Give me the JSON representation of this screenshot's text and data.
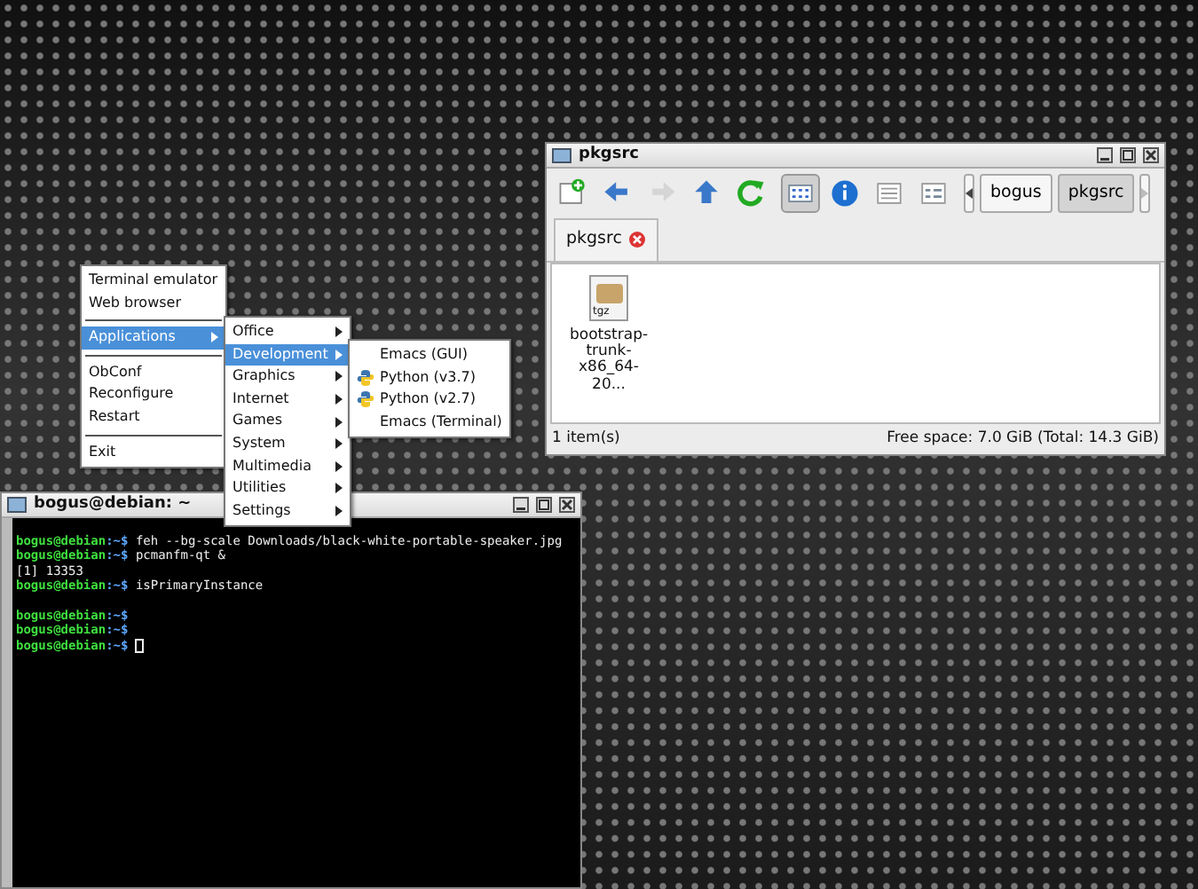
{
  "file_manager": {
    "title": "pkgsrc",
    "toolbar": [
      {
        "kind": "new-tab",
        "disabled": false,
        "selected": false
      },
      {
        "kind": "back",
        "disabled": false,
        "selected": false
      },
      {
        "kind": "forward",
        "disabled": true,
        "selected": false
      },
      {
        "kind": "up",
        "disabled": false,
        "selected": false
      },
      {
        "kind": "reload",
        "disabled": false,
        "selected": false
      },
      {
        "kind": "icon-view",
        "disabled": false,
        "selected": true
      },
      {
        "kind": "info",
        "disabled": false,
        "selected": false
      },
      {
        "kind": "detail-view",
        "disabled": false,
        "selected": false
      },
      {
        "kind": "compact-view",
        "disabled": false,
        "selected": false
      }
    ],
    "breadcrumb": [
      {
        "label": "bogus",
        "selected": false
      },
      {
        "label": "pkgsrc",
        "selected": true
      }
    ],
    "tabs": [
      {
        "label": "pkgsrc",
        "selected": true
      }
    ],
    "files": [
      {
        "badge": "tgz",
        "name_lines": [
          "bootstrap-",
          "trunk-",
          "x86_64-20..."
        ]
      }
    ],
    "status_left": "1 item(s)",
    "status_right": "Free space: 7.0 GiB (Total: 14.3 GiB)"
  },
  "root_menu": [
    {
      "kind": "item",
      "label": "Terminal emulator",
      "selected": false
    },
    {
      "kind": "item",
      "label": "Web browser",
      "selected": false
    },
    {
      "kind": "separator"
    },
    {
      "kind": "submenu",
      "label": "Applications",
      "selected": true
    },
    {
      "kind": "separator"
    },
    {
      "kind": "item",
      "label": "ObConf",
      "selected": false
    },
    {
      "kind": "item",
      "label": "Reconfigure",
      "selected": false
    },
    {
      "kind": "item",
      "label": "Restart",
      "selected": false
    },
    {
      "kind": "separator"
    },
    {
      "kind": "item",
      "label": "Exit",
      "selected": false
    }
  ],
  "applications_menu": [
    {
      "label": "Office",
      "selected": false
    },
    {
      "label": "Development",
      "selected": true
    },
    {
      "label": "Graphics",
      "selected": false
    },
    {
      "label": "Internet",
      "selected": false
    },
    {
      "label": "Games",
      "selected": false
    },
    {
      "label": "System",
      "selected": false
    },
    {
      "label": "Multimedia",
      "selected": false
    },
    {
      "label": "Utilities",
      "selected": false
    },
    {
      "label": "Settings",
      "selected": false
    }
  ],
  "development_menu": [
    {
      "label": "Emacs (GUI)",
      "kind": "plain"
    },
    {
      "label": "Python (v3.7)",
      "kind": "python"
    },
    {
      "label": "Python (v2.7)",
      "kind": "python"
    },
    {
      "label": "Emacs (Terminal)",
      "kind": "plain"
    }
  ],
  "terminal": {
    "title": "bogus@debian: ~",
    "lines": [
      {
        "kind": "prompt",
        "user": "bogus@debian",
        "path": ":~$",
        "text": "feh --bg-scale Downloads/black-white-portable-speaker.jpg"
      },
      {
        "kind": "prompt",
        "user": "bogus@debian",
        "path": ":~$",
        "text": "pcmanfm-qt &"
      },
      {
        "kind": "output",
        "text": "[1] 13353"
      },
      {
        "kind": "prompt",
        "user": "bogus@debian",
        "path": ":~$",
        "text": "isPrimaryInstance"
      },
      {
        "kind": "blank"
      },
      {
        "kind": "prompt",
        "user": "bogus@debian",
        "path": ":~$"
      },
      {
        "kind": "prompt",
        "user": "bogus@debian",
        "path": ":~$"
      },
      {
        "kind": "prompt",
        "user": "bogus@debian",
        "path": ":~$",
        "cursor": true
      }
    ]
  }
}
